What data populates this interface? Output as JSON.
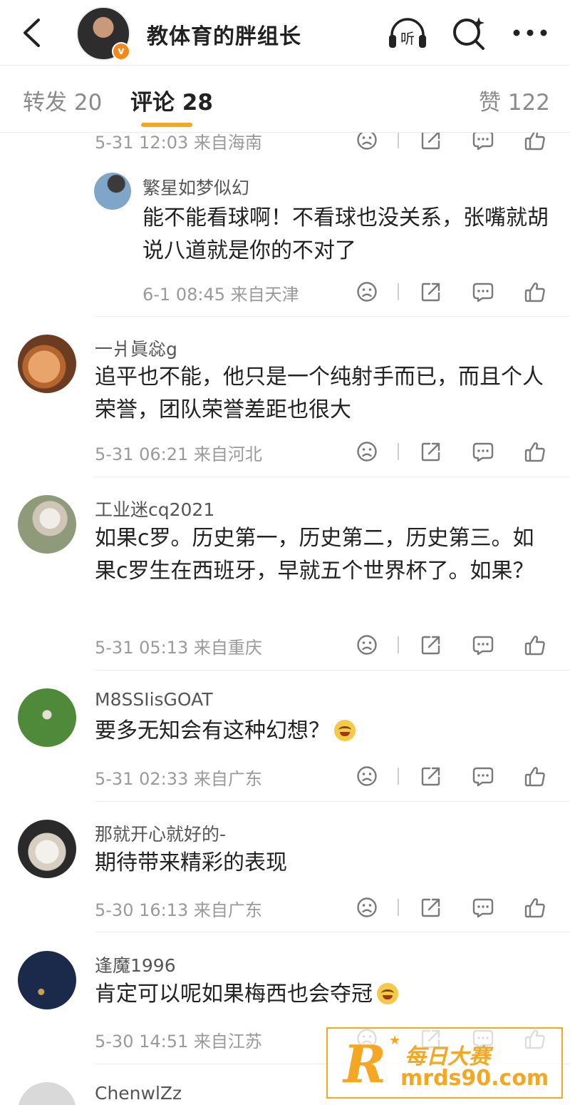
{
  "header": {
    "title": "教体育的胖组长",
    "verified_badge": "v",
    "listen_label": "听",
    "icons": [
      "back-icon",
      "headphones-listen-icon",
      "search-sparkle-icon",
      "more-icon"
    ]
  },
  "tabs": {
    "repost": "转发 20",
    "comments": "评论 28",
    "likes": "赞 122",
    "accent_color": "#f5a623"
  },
  "comments": [
    {
      "username": "",
      "text": "",
      "meta": "5-31 12:03 来自海南",
      "reply": {
        "username": "繁星如梦似幻",
        "text": "能不能看球啊！不看球也没关系，张嘴就胡说八道就是你的不对了",
        "meta": "6-1 08:45 来自天津"
      }
    },
    {
      "username": "一爿眞惢g",
      "text": "追平也不能，他只是一个纯射手而已，而且个人荣誉，团队荣誉差距也很大",
      "meta": "5-31 06:21 来自河北"
    },
    {
      "username": "工业迷cq2021",
      "text": "如果c罗。历史第一，历史第二，历史第三。如果c罗生在西班牙，早就五个世界杯了。如果？",
      "meta": "5-31 05:13 来自重庆"
    },
    {
      "username": "M8SSIisGOAT",
      "text": "要多无知会有这种幻想？",
      "meta": "5-31 02:33 来自广东"
    },
    {
      "username": "那就开心就好的-",
      "text": "期待带来精彩的表现",
      "meta": "5-30 16:13 来自广东"
    },
    {
      "username": "逢魔1996",
      "text": "肯定可以呢如果梅西也会夺冠",
      "meta": "5-30 14:51 来自江苏"
    },
    {
      "username": "ChenwlZz",
      "text": "",
      "meta": ""
    }
  ],
  "watermark": {
    "logo_letter": "R",
    "line1": "每日大赛",
    "line2": "mrds90.com"
  }
}
